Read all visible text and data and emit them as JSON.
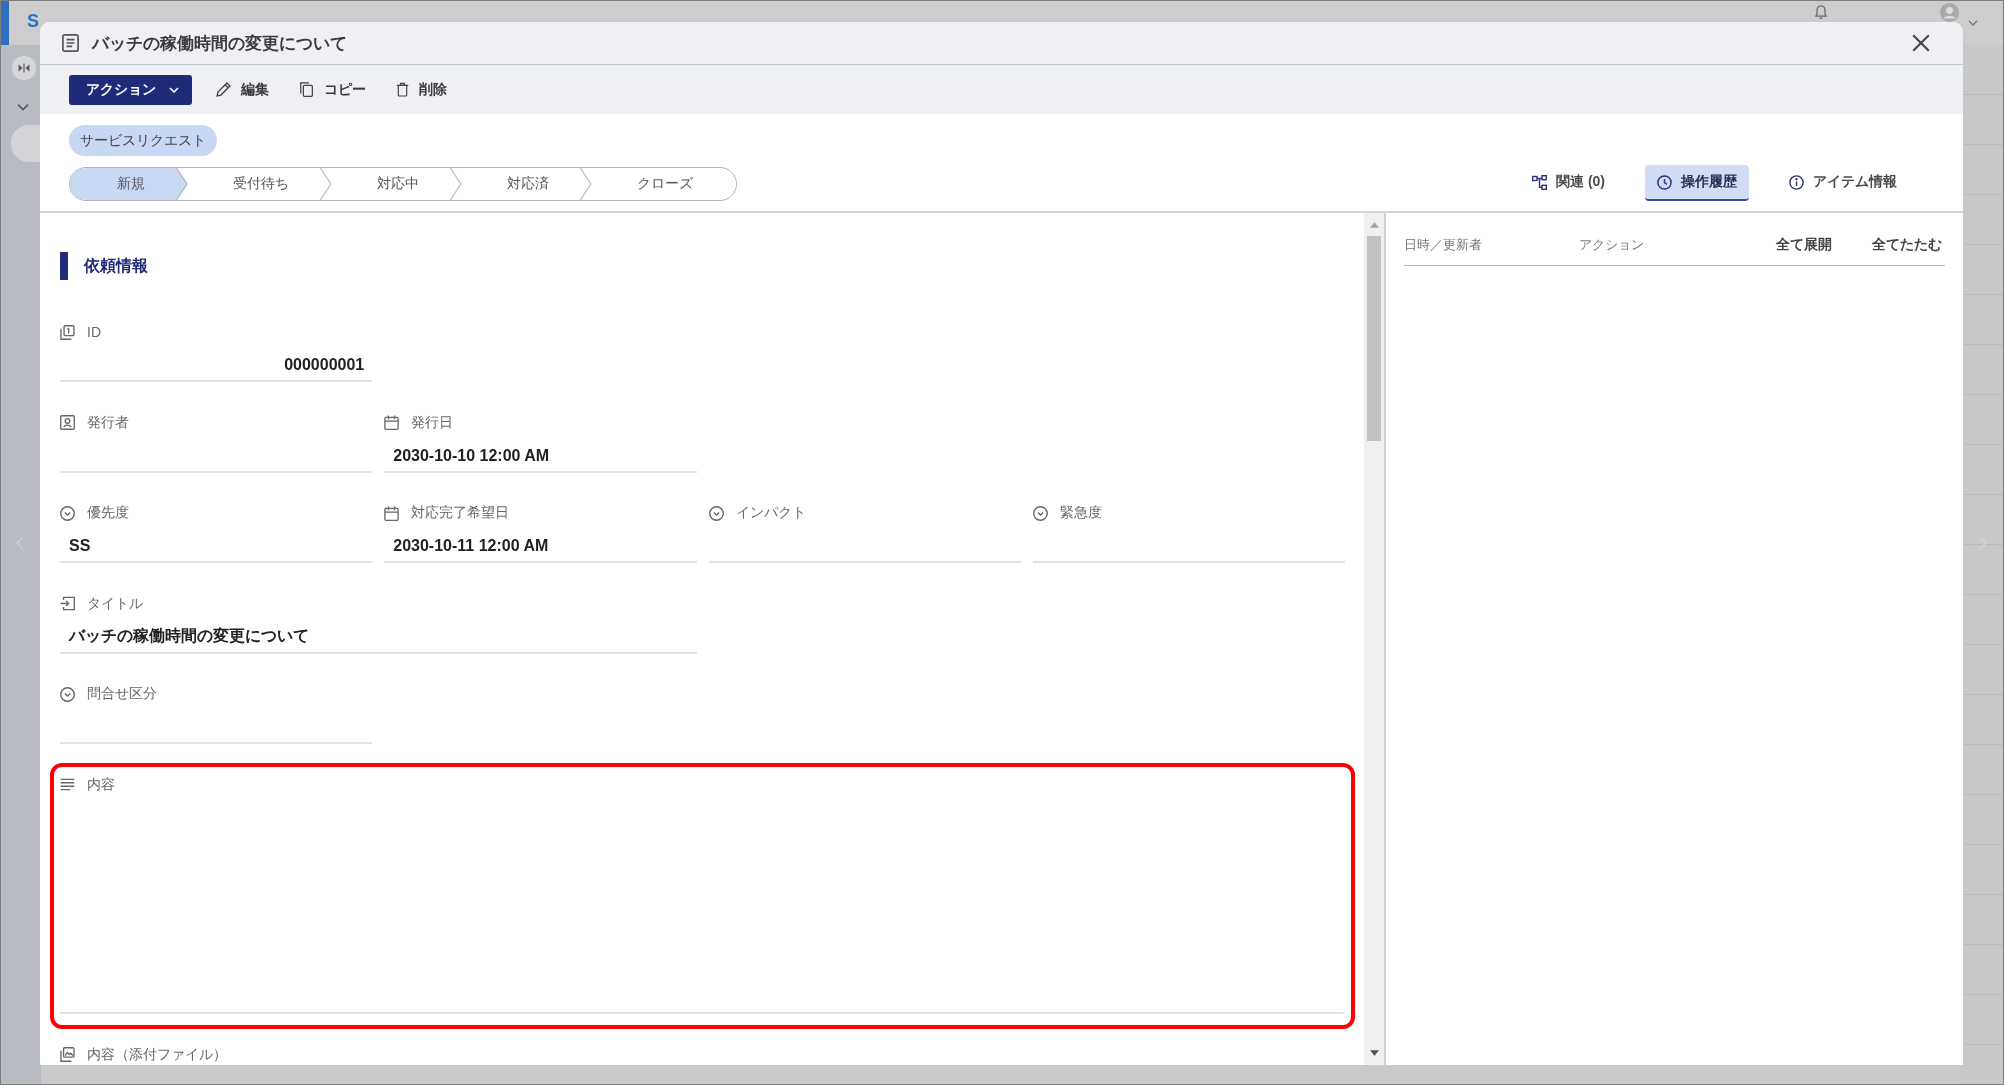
{
  "app": {
    "title": "S"
  },
  "window": {
    "title": "バッチの稼働時間の変更について"
  },
  "toolbar": {
    "menu": {
      "label": "アクション"
    },
    "buttons": [
      {
        "kind": "edit",
        "label": "編集"
      },
      {
        "kind": "copy",
        "label": "コピー"
      },
      {
        "kind": "delete",
        "label": "削除"
      }
    ]
  },
  "record_type": {
    "label": "サービスリクエスト"
  },
  "status_steps": [
    {
      "label": "新規",
      "selected": true
    },
    {
      "label": "受付待ち",
      "selected": false
    },
    {
      "label": "対応中",
      "selected": false
    },
    {
      "label": "対応済",
      "selected": false
    },
    {
      "label": "クローズ",
      "selected": false
    }
  ],
  "side_tabs": [
    {
      "kind": "related",
      "label": "関連 (0)",
      "selected": false
    },
    {
      "kind": "history",
      "label": "操作履歴",
      "selected": true
    },
    {
      "kind": "info",
      "label": "アイテム情報",
      "selected": false
    }
  ],
  "form": {
    "section_title": "依頼情報",
    "rows": [
      {
        "fields": [
          {
            "kind": "id",
            "label": "ID",
            "value": "000000001",
            "highlighted": false
          }
        ]
      },
      {
        "fields": [
          {
            "kind": "person",
            "label": "発行者",
            "highlighted": false
          },
          {
            "kind": "date",
            "label": "発行日",
            "value": "2030-10-10 12:00 AM",
            "highlighted": false
          }
        ]
      },
      {
        "fields": [
          {
            "kind": "select",
            "label": "優先度",
            "value": "SS",
            "highlighted": false
          },
          {
            "kind": "date",
            "label": "対応完了希望日",
            "value": "2030-10-11 12:00 AM",
            "highlighted": false
          },
          {
            "kind": "select",
            "label": "インパクト",
            "highlighted": false
          },
          {
            "kind": "select",
            "label": "緊急度",
            "highlighted": false
          }
        ]
      },
      {
        "fields": [
          {
            "kind": "text",
            "label": "タイトル",
            "value": "バッチの稼働時間の変更について",
            "highlighted": false
          }
        ]
      },
      {
        "fields": [
          {
            "kind": "select",
            "label": "問合せ区分",
            "highlighted": false
          }
        ]
      },
      {
        "fields": [
          {
            "kind": "multiline",
            "label": "内容",
            "highlighted": true
          }
        ]
      },
      {
        "fields": [
          {
            "kind": "attachment",
            "label": "内容（添付ファイル）",
            "highlighted": false
          }
        ]
      }
    ]
  },
  "history": {
    "columns": [
      "日時／更新者",
      "アクション"
    ],
    "actions": [
      "全て展開",
      "全てたたむ"
    ]
  }
}
